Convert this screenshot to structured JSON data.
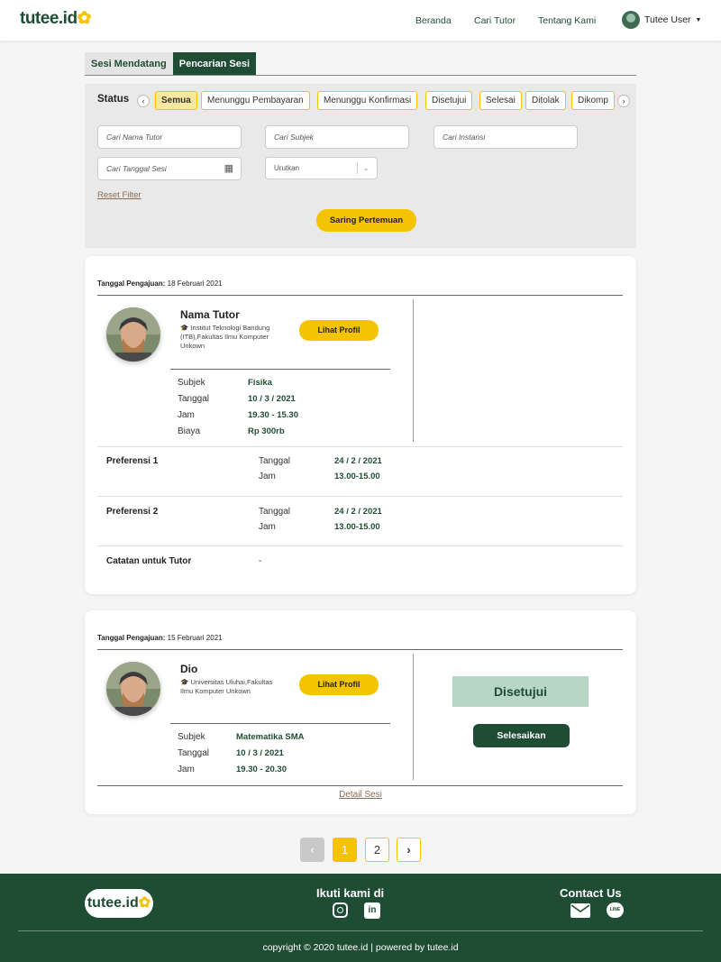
{
  "header": {
    "logo": "tutee.id",
    "nav": [
      "Beranda",
      "Cari Tutor",
      "Tentang Kami"
    ],
    "user": "Tutee User"
  },
  "tabs": [
    "Sesi Mendatang",
    "Pencarian Sesi"
  ],
  "filter": {
    "status_label": "Status",
    "chips": [
      "Semua",
      "Menunggu Pembayaran",
      "Menunggu Konfirmasi",
      "Disetujui",
      "Selesai",
      "Ditolak",
      "Dikomp"
    ],
    "selected_chip": "Semua",
    "placeholders": {
      "tutor": "Cari Nama Tutor",
      "subject": "Cari Subjek",
      "institution": "Cari Instansi",
      "date": "Cari Tanggal Sesi"
    },
    "sort": "Urutkan",
    "reset": "Reset Filter",
    "submit": "Saring Pertemuan"
  },
  "card1": {
    "submitted_label": "Tanggal Pengajuan:",
    "submitted": "18 Februari 2021",
    "name": "Nama Tutor",
    "institution": "Institut Teknologi Bandung (ITB),Fakultas Ilmu Komputer Unkown",
    "profile_btn": "Lihat Profil",
    "labels": [
      "Subjek",
      "Tanggal",
      "Jam",
      "Biaya"
    ],
    "values": [
      "Fisika",
      "10 / 3 / 2021",
      "19.30 - 15.30",
      "Rp 300rb"
    ],
    "pref1_label": "Preferensi 1",
    "pref2_label": "Preferensi 2",
    "pref_date_label": "Tanggal",
    "pref_time_label": "Jam",
    "pref1_date": "24 / 2 / 2021",
    "pref1_time": "13.00-15.00",
    "pref2_date": "24 / 2 / 2021",
    "pref2_time": "13.00-15.00",
    "note_label": "Catatan untuk Tutor",
    "note": "-"
  },
  "card2": {
    "submitted_label": "Tanggal Pengajuan:",
    "submitted": "15 Februari 2021",
    "name": "Dio",
    "institution": "Universitas Uluhai,Fakultas Ilmu Komputer Unkown",
    "profile_btn": "Lihat Profil",
    "labels": [
      "Subjek",
      "Tanggal",
      "Jam"
    ],
    "values": [
      "Matematika SMA",
      "10 / 3 / 2021",
      "19.30 - 20.30"
    ],
    "status": "Disetujui",
    "action": "Selesaikan",
    "detail_link": "Detail Sesi"
  },
  "pagination": {
    "pages": [
      "1",
      "2"
    ],
    "current": "1"
  },
  "footer": {
    "logo": "tutee.id",
    "follow": "Ikuti kami di",
    "contact": "Contact Us",
    "line_label": "LINE",
    "copyright": "copyright © 2020 tutee.id | powered by tutee.id"
  },
  "colors": {
    "brand_green": "#1f4d33",
    "accent_yellow": "#f5c400",
    "status_green_bg": "#b8d6c5"
  }
}
